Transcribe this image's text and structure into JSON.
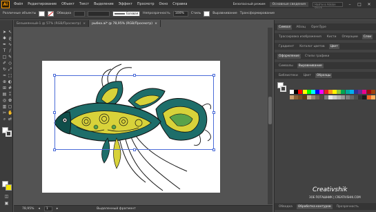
{
  "menubar": {
    "logo": "Ai",
    "items": [
      "Файл",
      "Редактирование",
      "Объект",
      "Текст",
      "Выделение",
      "Эффект",
      "Просмотр",
      "Окно",
      "Справка"
    ],
    "sync_label": "Безопасный режим",
    "workspace": "Основные сведения",
    "search_placeholder": "Найти в Adobe Stock"
  },
  "control_bar": {
    "selection_label": "Различные объекты",
    "stroke_label": "Обводка",
    "brush_label": "Базовая",
    "opacity_label": "Непрозрачность",
    "opacity_value": "100%",
    "style_label": "Стиль",
    "align_label": "Выравнивание",
    "transform_label": "Трансформирование"
  },
  "doc_tabs": [
    {
      "label": "Безымянный-1 @ 57% (RGB/Просмотр)",
      "close": "×"
    },
    {
      "label": "рыбка.ai* @ 78,95% (RGB/Просмотр)",
      "close": "×"
    }
  ],
  "status": {
    "zoom": "78,95%",
    "page": "1",
    "selection": "Выделенный фрагмент"
  },
  "panels": {
    "row1": [
      "Символ",
      "Абзац",
      "OpenType"
    ],
    "row2": [
      "Трассировка изображения",
      "Кисти",
      "Операции",
      "Слои"
    ],
    "row3": [
      "Градиент",
      "Каталог цветов",
      "Цвет"
    ],
    "row4": [
      "Оформление",
      "Стили графики"
    ],
    "row5": [
      "Символы",
      "Выравнивание"
    ],
    "row6": [
      "Библиотеки",
      "Цвет",
      "Образцы"
    ],
    "bottom": [
      "Обводка",
      "Обработка контуров",
      "Прозрачность"
    ]
  },
  "watermark": {
    "brand": "Creativshik",
    "caption": "ЗОЕ ПОТАШНИК | CREATIVSHIK.COM"
  },
  "colors": {
    "accent": "#ff9a00",
    "selection_box": "#4a6bd8",
    "fish_teal": "#1e6e6a",
    "fish_yellow": "#d8d23a"
  }
}
